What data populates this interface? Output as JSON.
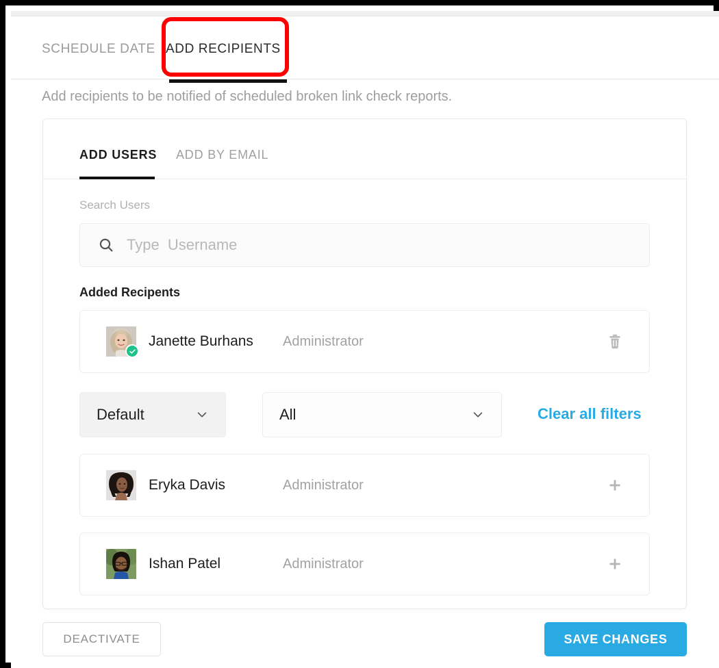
{
  "window": {
    "annotation_color": "#fe0000",
    "accent_color": "#29aae3"
  },
  "top_tabs": [
    {
      "label": "SCHEDULE DATE",
      "active": false
    },
    {
      "label": "ADD RECIPIENTS",
      "active": true
    }
  ],
  "description": "Add recipients to be notified of scheduled broken link check reports.",
  "card": {
    "tabs": [
      {
        "label": "ADD USERS",
        "active": true
      },
      {
        "label": "ADD BY EMAIL",
        "active": false
      }
    ],
    "search": {
      "label": "Search Users",
      "placeholder": "Type  Username",
      "value": "",
      "icon": "search-icon"
    },
    "added_section": {
      "title": "Added Recipents",
      "recipients": [
        {
          "name": "Janette Burhans",
          "role": "Administrator",
          "verified": true,
          "action_icon": "trash-icon"
        }
      ]
    },
    "filters": {
      "sort": {
        "value": "Default",
        "caret_icon": "chevron-down-icon"
      },
      "role": {
        "value": "All",
        "caret_icon": "chevron-down-icon"
      },
      "clear_label": "Clear all filters"
    },
    "available_users": [
      {
        "name": "Eryka Davis",
        "role": "Administrator",
        "action_icon": "plus-icon"
      },
      {
        "name": "Ishan Patel",
        "role": "Administrator",
        "action_icon": "plus-icon"
      }
    ]
  },
  "footer": {
    "deactivate_label": "DEACTIVATE",
    "save_label": "SAVE CHANGES"
  }
}
